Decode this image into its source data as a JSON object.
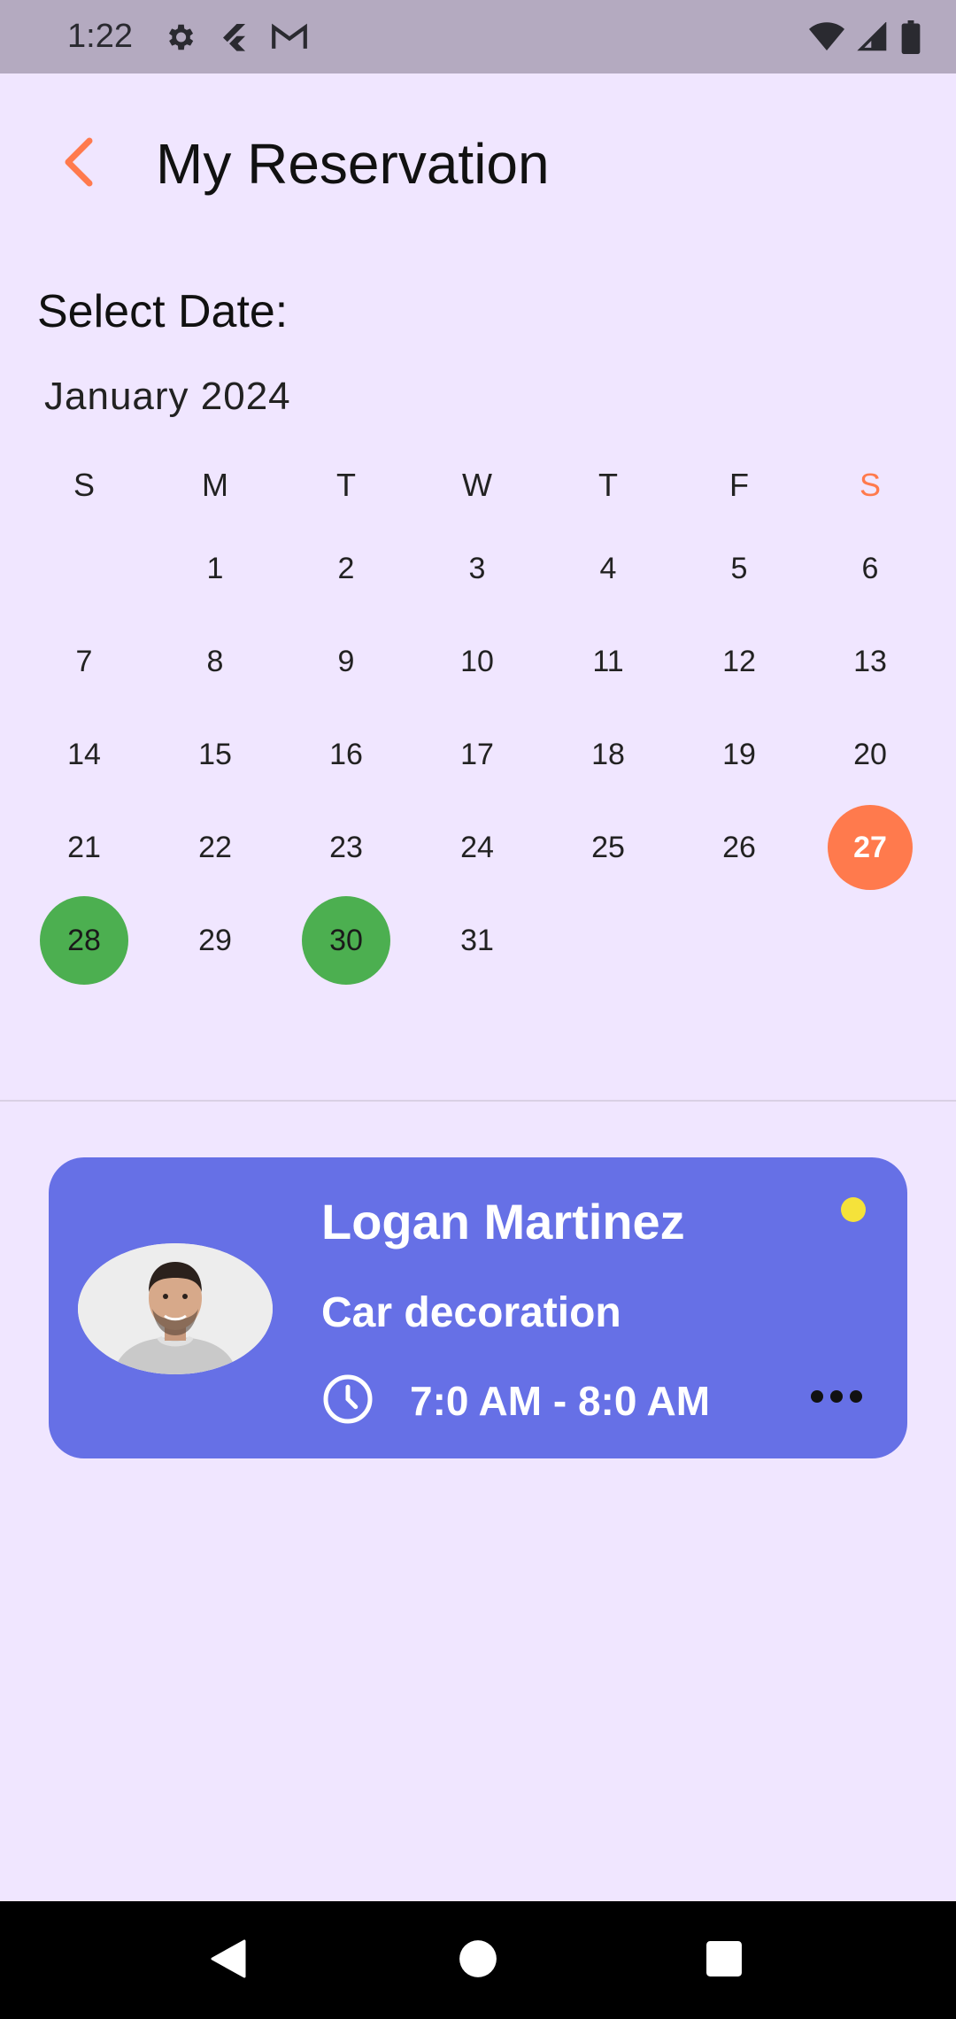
{
  "status_bar": {
    "time": "1:22",
    "left_icons": [
      "settings-icon",
      "flutter-icon",
      "gmail-icon"
    ],
    "right_icons": [
      "wifi-icon",
      "signal-icon",
      "battery-icon"
    ]
  },
  "header": {
    "back_icon": "chevron-left-icon",
    "title": "My Reservation"
  },
  "select_date_label": "Select Date:",
  "calendar": {
    "month_label": "January 2024",
    "weekdays": [
      "S",
      "M",
      "T",
      "W",
      "T",
      "F",
      "S"
    ],
    "weeks": [
      [
        "",
        "1",
        "2",
        "3",
        "4",
        "5",
        "6"
      ],
      [
        "7",
        "8",
        "9",
        "10",
        "11",
        "12",
        "13"
      ],
      [
        "14",
        "15",
        "16",
        "17",
        "18",
        "19",
        "20"
      ],
      [
        "21",
        "22",
        "23",
        "24",
        "25",
        "26",
        "27"
      ],
      [
        "28",
        "29",
        "30",
        "31",
        "",
        "",
        ""
      ]
    ],
    "selected_day": "27",
    "booked_days": [
      "28",
      "30"
    ]
  },
  "reservation": {
    "name": "Logan Martinez",
    "service": "Car decoration",
    "time": "7:0 AM - 8:0 AM",
    "status_color": "#f5e23a",
    "avatar_icon": "profile-photo",
    "clock_icon": "clock-icon",
    "more_icon": "more-horizontal-icon"
  },
  "nav_bar": {
    "back_icon": "nav-back-icon",
    "home_icon": "nav-home-icon",
    "recents_icon": "nav-recents-icon"
  },
  "colors": {
    "accent": "#ff7a4d",
    "booked": "#4caf50",
    "card": "#6670e6",
    "background": "#f0e6ff"
  }
}
